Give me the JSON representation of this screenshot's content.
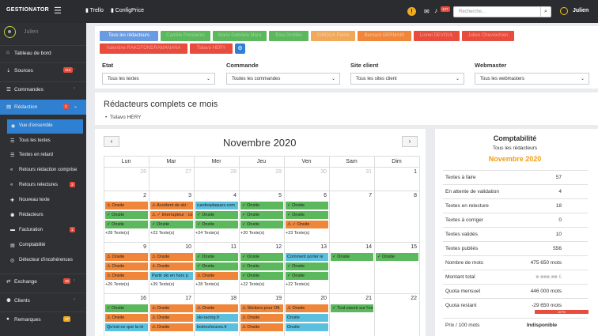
{
  "topbar": {
    "logo": "GESTIONATOR",
    "links": [
      "Trello",
      "ConfigPrice"
    ],
    "notif_badge": "137",
    "search_placeholder": "Recherche...",
    "user": "Julien"
  },
  "sidebar": {
    "user_name": "Julien",
    "items": [
      {
        "label": "Tableau de bord",
        "icon": "home-icon",
        "glyph": "⌂"
      },
      {
        "label": "Sources",
        "icon": "download-icon",
        "glyph": "⇣",
        "badge": "312"
      },
      {
        "label": "Commandes",
        "icon": "cart-icon",
        "glyph": "☰"
      },
      {
        "label": "Rédaction",
        "icon": "document-icon",
        "glyph": "▤",
        "badge": "2"
      }
    ],
    "subitems": [
      {
        "label": "Vue d'ensemble",
        "glyph": "◉"
      },
      {
        "label": "Tous les textes",
        "glyph": "☰"
      },
      {
        "label": "Textes en retard",
        "glyph": "☰"
      },
      {
        "label": "Retours rédaction comprise",
        "glyph": "«"
      },
      {
        "label": "Retours relectures",
        "glyph": "«",
        "badge": "3"
      },
      {
        "label": "Nouveau texte",
        "glyph": "✚"
      },
      {
        "label": "Rédacteurs",
        "glyph": "⚉"
      },
      {
        "label": "Facturation",
        "glyph": "▬",
        "badge": "1"
      },
      {
        "label": "Comptabilité",
        "glyph": "▤"
      },
      {
        "label": "Détecteur d'incohérences",
        "glyph": "◎"
      }
    ],
    "items2": [
      {
        "label": "Exchange",
        "glyph": "⇄",
        "badge": "26"
      },
      {
        "label": "Clients",
        "glyph": "⚉"
      },
      {
        "label": "Remarques",
        "glyph": "●",
        "badge": "37"
      }
    ]
  },
  "writers": [
    "Tous les rédacteurs",
    "Camille Pondaries",
    "Marie Gabriela Mara",
    "Elsa Grobbe",
    "GIROUX Pierre",
    "Bernard GERMAIN",
    "Lionel DEVOUL",
    "Julien Chevrechien",
    "Valentine RAKOTONDRAMANANA",
    "Tsilavo HERY"
  ],
  "filters": {
    "etat": {
      "label": "Etat",
      "value": "Tous les textes"
    },
    "commande": {
      "label": "Commande",
      "value": "Toutes les commandes"
    },
    "site": {
      "label": "Site client",
      "value": "Tous les sites client"
    },
    "webmaster": {
      "label": "Webmaster",
      "value": "Tous les webmasters"
    }
  },
  "complete": {
    "title": "Rédacteurs complets ce mois",
    "items": [
      "Tsilavo HERY"
    ]
  },
  "calendar": {
    "month": "Novembre 2020",
    "days": [
      "Lun",
      "Mar",
      "Mer",
      "Jeu",
      "Ven",
      "Sam",
      "Dim"
    ],
    "weeks": [
      {
        "nums": [
          "26",
          "27",
          "28",
          "29",
          "30",
          "31",
          "1"
        ],
        "grey": [
          1,
          1,
          1,
          1,
          1,
          1,
          0
        ]
      },
      {
        "nums": [
          "2",
          "3",
          "4",
          "5",
          "6",
          "7",
          "8"
        ],
        "grey": [
          0,
          0,
          0,
          0,
          0,
          0,
          0
        ],
        "events": [
          [
            "⚠ Onsite",
            "⚠ Accident de ski :",
            "ruedesplaques.com",
            "✓ Onsite",
            "✓ Onsite",
            "",
            ""
          ],
          [
            "✓ Onsite",
            "⚠ ✓ Interrupteur : co",
            "✓ Onsite",
            "✓ Onsite",
            "✓ Onsite",
            "",
            ""
          ],
          [
            "✓ Onsite",
            "✓ Onsite",
            "✓ Onsite",
            "✓ Onsite",
            "⚠ ✓ Onsite",
            "",
            ""
          ]
        ],
        "more": [
          "+28 Texte(s)",
          "+23 Texte(s)",
          "+24 Texte(s)",
          "+20 Texte(s)",
          "+23 Texte(s)",
          "",
          ""
        ]
      },
      {
        "nums": [
          "9",
          "10",
          "11",
          "12",
          "13",
          "14",
          "15"
        ],
        "grey": [
          0,
          0,
          0,
          0,
          0,
          0,
          0
        ],
        "events": [
          [
            "⚠ Onsite",
            "⚠ Onsite",
            "✓ Onsite",
            "✓ Onsite",
            "Comment porter le",
            "✓ Onsite",
            "✓ Onsite"
          ],
          [
            "⚠ Onsite",
            "⚠ Onsite",
            "✓ Onsite",
            "✓ Onsite",
            "✓ Onsite",
            "",
            ""
          ],
          [
            "⚠ Onsite",
            "Partir ski en hors p",
            "⚠ Onsite",
            "✓ Onsite",
            "✓ Onsite",
            "",
            ""
          ]
        ],
        "more": [
          "+26 Texte(s)",
          "+39 Texte(s)",
          "+28 Texte(s)",
          "+22 Texte(s)",
          "+22 Texte(s)",
          "",
          ""
        ]
      },
      {
        "nums": [
          "16",
          "17",
          "18",
          "19",
          "20",
          "21",
          "22"
        ],
        "grey": [
          0,
          0,
          0,
          0,
          0,
          0,
          0
        ],
        "events": [
          [
            "✓ Onsite",
            "⚠ Onsite",
            "⚠ Onsite",
            "⚠ Stickers pour Oft",
            "⚠ Onsite",
            "✓ Tout savoir sur l'es",
            ""
          ],
          [
            "⚠ Onsite",
            "⚠ Onsite",
            "ski-racing.fr",
            "⚠ Onsite",
            "Onsite",
            "",
            ""
          ],
          [
            "Qu'est-ce que la ré",
            "⚠ Onsite",
            "lestrocheures.fr",
            "⚠ Onsite",
            "Onsite",
            "",
            ""
          ]
        ]
      }
    ]
  },
  "compta": {
    "title": "Comptabilité",
    "subtitle": "Tous les rédacteurs",
    "month": "Novembre 2020",
    "rows": [
      [
        "Textes à faire",
        "57"
      ],
      [
        "En attente de validation",
        "4"
      ],
      [
        "Textes en relecture",
        "18"
      ],
      [
        "Textes à corriger",
        "0"
      ],
      [
        "Textes validés",
        "10"
      ],
      [
        "Textes publiés",
        "556"
      ],
      [
        "Nombre de mots",
        "475 650 mots"
      ],
      [
        "Montant total",
        "■ ■■■,■■ €"
      ],
      [
        "Quota mensuel",
        "446 000 mots"
      ],
      [
        "Quota restant",
        "-29 650 mots"
      ],
      [
        "Prix / 100 mots",
        "Indisponible"
      ]
    ],
    "quota_progress_label": "107%"
  },
  "colors": {
    "accent": "#2f80d0",
    "green": "#5cb85c",
    "orange": "#f0863a",
    "red": "#e74c3c",
    "blue": "#5bc0de",
    "sidebar": "#2f3033"
  }
}
